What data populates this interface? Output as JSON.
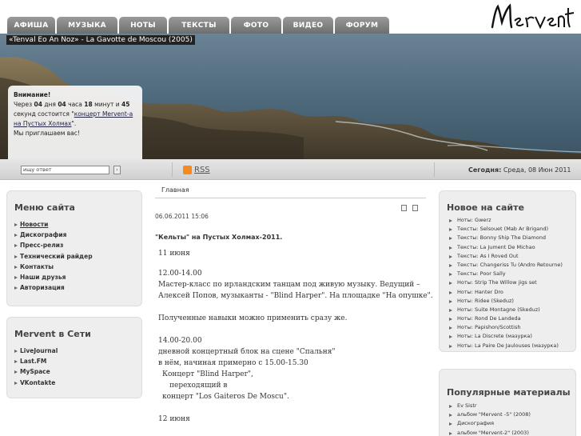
{
  "nav": [
    "АФИША",
    "МУЗЫКА",
    "НОТЫ",
    "ТЕКСТЫ",
    "ФОТО",
    "ВИДЕО",
    "ФОРУМ"
  ],
  "logo_text": "Mervent",
  "hero": {
    "caption": "«Tenval Eo An Noz» - La Gavotte de Moscou (2005)"
  },
  "notice": {
    "title": "Внимание!",
    "p1": "Через ",
    "days": "04",
    "p2": " дня ",
    "hours": "04",
    "p3": " часа ",
    "minutes": "18",
    "p4": " минут и ",
    "seconds": "45",
    "p5": " секунд состоится \"",
    "link": "концерт Mervent-а на Пустых Холмах",
    "p6": "\".",
    "footer": "Мы приглашаем вас!"
  },
  "search": {
    "value": "ищу ответ",
    "button": "›"
  },
  "rss": "RSS",
  "today": {
    "label": "Сегодня:",
    "value": "Среда, 08 Июн 2011"
  },
  "left_menu": {
    "title": "Меню сайта",
    "items": [
      "Новости",
      "Дискография",
      "Пресс-релиз",
      "Технический райдер",
      "Контакты",
      "Наши друзья",
      "Авторизация"
    ]
  },
  "left_net": {
    "title": "Mervent в Сети",
    "items": [
      "LiveJournal",
      "Last.FM",
      "MySpace",
      "VKontakte"
    ]
  },
  "article": {
    "breadcrumb": "Главная",
    "date": "06.06.2011 15:06",
    "title": "\"Кельты\" на Пустых Холмах-2011.",
    "lines": [
      "11 июня",
      "12.00-14.00",
      "Мастер-класс по ирландским танцам под живую музыку. Ведущий –",
      "Алексей Попов, музыканты - \"Blind Harper\".  На площадке \"На опушке\".",
      "Полученные навыки можно применить сразу же.",
      "14.00-20.00",
      "дневной концертный блок на сцене \"Спальня\"",
      "в нём, начиная примерно с 15.00-15.30",
      "  Концерт \"Blind Harper\",",
      "     переходящий в",
      "  концерт \"Los Gaiteros De Moscu\".",
      "12 июня"
    ]
  },
  "new_on_site": {
    "title": "Новое на сайте",
    "items": [
      "Ноты: Gwerz",
      "Тексты: Selsouet (Mab Ar Brigand)",
      "Тексты: Bonny Ship The Diamond",
      "Тексты: La Jument De Michao",
      "Тексты: As I Roved Out",
      "Тексты: Changeriss Tu (Andro Retourne)",
      "Тексты: Poor Sally",
      "Ноты: Strip The Willow jigs set",
      "Ноты: Hanter Dro",
      "Ноты: Ridee (Skeduz)",
      "Ноты: Suite Montagne (Skeduz)",
      "Ноты: Rond De Landeda",
      "Ноты: Papishon/Scottish",
      "Ноты: La Discrete (мазурка)",
      "Ноты: La Paire De Jaulouses (мазурка)"
    ]
  },
  "popular": {
    "title": "Популярные материалы",
    "items": [
      "Ev Sistr",
      "альбом \"Mervent -5\" (2008)",
      "Дискография",
      "альбом \"Mervent-2\" (2003)"
    ]
  },
  "colors": {
    "tab": "#7f7f7f",
    "box": "#eeeeee"
  }
}
